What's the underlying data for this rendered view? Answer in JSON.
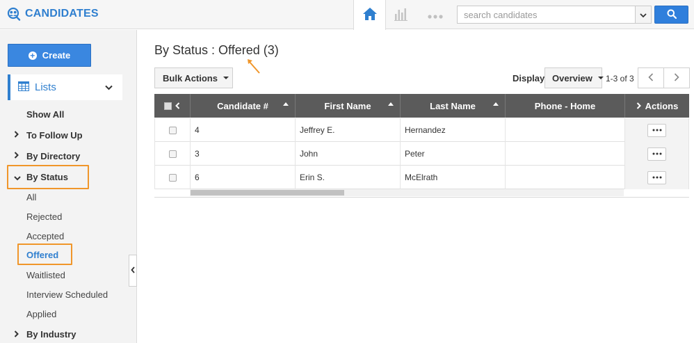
{
  "app": {
    "title": "CANDIDATES",
    "search": {
      "placeholder": "search candidates"
    }
  },
  "sidebar": {
    "create_label": "Create",
    "lists_label": "Lists",
    "items": [
      {
        "label": "Show All",
        "level": 0,
        "caret": ""
      },
      {
        "label": "To Follow Up",
        "level": 0,
        "caret": "right"
      },
      {
        "label": "By Directory",
        "level": 0,
        "caret": "right"
      },
      {
        "label": "By Status",
        "level": 0,
        "caret": "down"
      },
      {
        "label": "All",
        "level": 1
      },
      {
        "label": "Rejected",
        "level": 1
      },
      {
        "label": "Accepted",
        "level": 1
      },
      {
        "label": "Offered",
        "level": 1,
        "active": true
      },
      {
        "label": "Waitlisted",
        "level": 1
      },
      {
        "label": "Interview Scheduled",
        "level": 1
      },
      {
        "label": "Applied",
        "level": 1
      },
      {
        "label": "By Industry",
        "level": 0,
        "caret": "right"
      }
    ]
  },
  "main": {
    "page_title": "By Status : Offered (3)",
    "bulk_actions_label": "Bulk Actions",
    "display_label": "Display",
    "view_selected": "Overview",
    "pager_text": "1-3 of 3",
    "columns": [
      "Candidate #",
      "First Name",
      "Last Name",
      "Phone - Home",
      "Actions"
    ],
    "rows": [
      {
        "candidate": "4",
        "first": "Jeffrey E.",
        "last": "Hernandez",
        "phone": ""
      },
      {
        "candidate": "3",
        "first": "John",
        "last": "Peter",
        "phone": ""
      },
      {
        "candidate": "6",
        "first": "Erin S.",
        "last": "McElrath",
        "phone": ""
      }
    ]
  },
  "colors": {
    "brand": "#2f7fcf",
    "primary_button": "#3a87e0",
    "highlight_annotation": "#f0962a",
    "table_header": "#5b5b5b"
  },
  "icons": {
    "brand": "people-search-icon",
    "home": "home-icon",
    "reports": "bar-chart-icon",
    "more": "more-dots-icon",
    "search": "search-icon",
    "lists": "grid-list-icon"
  }
}
